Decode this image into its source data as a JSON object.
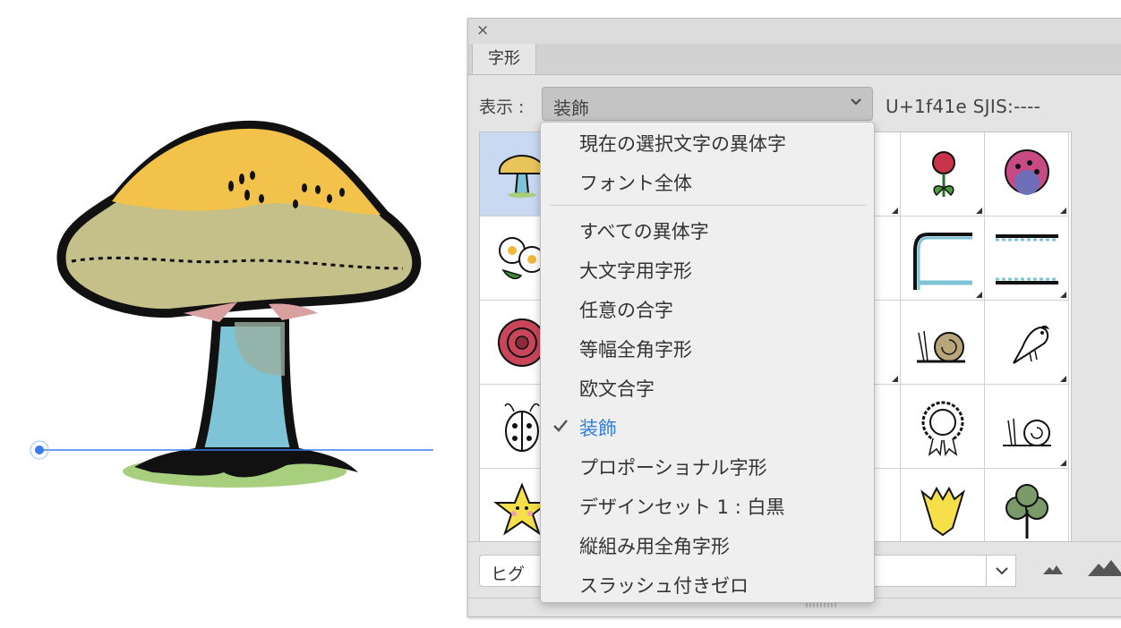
{
  "panel": {
    "tab_label": "字形",
    "close_glyph": "×",
    "show_label": "表示 :",
    "show_selected": "装飾",
    "code_readout": "U+1f41e SJIS:----",
    "font_name_partial": "ヒグ"
  },
  "menu": {
    "items": [
      "現在の選択文字の異体字",
      "フォント全体",
      "すべての異体字",
      "大文字用字形",
      "任意の合字",
      "等幅全角字形",
      "欧文合字",
      "装飾",
      "プロポーショナル字形",
      "デザインセット 1 : 白黒",
      "縦組み用全角字形",
      "スラッシュ付きゼロ"
    ],
    "checked_index": 7
  },
  "glyph_icons": [
    [
      "mushroom-icon",
      "blank",
      "blank",
      "partial-icon",
      "flower-bud-icon",
      "clover-flower-icon"
    ],
    [
      "daisy-icon",
      "blank",
      "blank",
      "partial-icon",
      "tape-frame-left-icon",
      "tape-frame-right-icon"
    ],
    [
      "rose-icon",
      "blank",
      "blank",
      "partial-icon",
      "snail-icon",
      "bird-icon"
    ],
    [
      "ladybug-icon",
      "blank",
      "blank",
      "partial-icon",
      "rosette-icon",
      "snail-small-icon"
    ],
    [
      "star-face-icon",
      "blank",
      "blank",
      "partial-icon",
      "tulip-icon",
      "shamrock-icon"
    ]
  ],
  "colors": {
    "accent": "#2f7ed8",
    "selected_cell": "#c9d9f2",
    "guide_line": "#3a7bf0"
  }
}
